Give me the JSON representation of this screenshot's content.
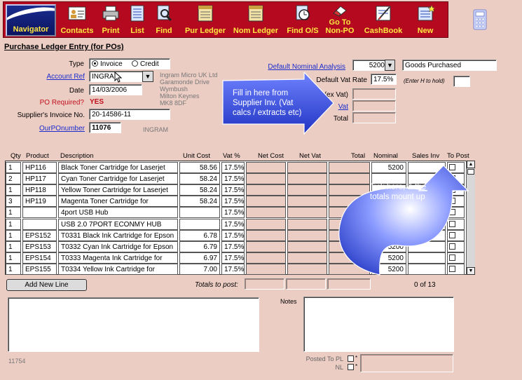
{
  "toolbar": {
    "navigator": "Navigator",
    "buttons": [
      {
        "label": "Contacts",
        "icon": "contacts-icon"
      },
      {
        "label": "Print",
        "icon": "printer-icon"
      },
      {
        "label": "List",
        "icon": "list-icon"
      },
      {
        "label": "Find",
        "icon": "find-icon"
      },
      {
        "label": "Pur Ledger",
        "icon": "ledger-icon"
      },
      {
        "label": "Nom Ledger",
        "icon": "ledger-icon"
      },
      {
        "label": "Find O/S",
        "icon": "stopwatch-icon"
      },
      {
        "label": "Go To",
        "label2": "Non-PO",
        "icon": "eraser-icon"
      },
      {
        "label": "CashBook",
        "icon": "cashbook-icon"
      },
      {
        "label": "New",
        "icon": "new-icon"
      }
    ]
  },
  "page_title": "Purchase Ledger Entry (for POs)",
  "form": {
    "type_label": "Type",
    "type_options": [
      "Invoice",
      "Credit"
    ],
    "account_ref_label": "Account Ref",
    "account_ref_value": "INGRA",
    "supplier_address": [
      "Ingram Micro UK Ltd",
      "Garamonde Drive",
      "Wymbush",
      "Milton Keynes",
      "MK8 8DF"
    ],
    "date_label": "Date",
    "date_value": "14/03/2006",
    "po_required_label": "PO Required?",
    "po_required_value": "YES",
    "supplier_invoice_label": "Supplier's Invoice  No.",
    "supplier_invoice_value": "20-14586-11",
    "our_po_label": "OurPOnumber",
    "our_po_value": "11076",
    "our_po_supplier": "INGRAM",
    "default_nominal_label": "Default Nominal Analysis",
    "default_nominal_code": "5200",
    "default_nominal_desc": "Goods Purchased",
    "default_vat_label": "Default Vat Rate",
    "default_vat_value": "17.5%",
    "hold_hint": "(Enter H to hold)",
    "ex_vat_label": "(ex Vat)",
    "vat_label": "Vat",
    "total_label": "Total"
  },
  "callouts": {
    "fill_in": "Fill in here from Supplier Inv. (Vat calcs / extracts etc)",
    "tick_here": "Tick here, & the totals mount up"
  },
  "table": {
    "headers": [
      "Qty",
      "Product",
      "Description",
      "Unit Cost",
      "Vat %",
      "Net Cost",
      "Net Vat",
      "Total",
      "Nominal",
      "Sales Inv",
      "To Post"
    ],
    "rows": [
      {
        "qty": "1",
        "product": "HP116",
        "description": "Black Toner Cartridge for Laserjet",
        "unit_cost": "58.56",
        "vat": "17.5%",
        "nominal": "5200"
      },
      {
        "qty": "2",
        "product": "HP117",
        "description": "Cyan Toner Cartridge for Laserjet",
        "unit_cost": "58.24",
        "vat": "17.5%",
        "nominal": ""
      },
      {
        "qty": "1",
        "product": "HP118",
        "description": "Yellow Toner Cartridge for Laserjet",
        "unit_cost": "58.24",
        "vat": "17.5%",
        "nominal": ""
      },
      {
        "qty": "3",
        "product": "HP119",
        "description": "Magenta Toner Cartridge for",
        "unit_cost": "58.24",
        "vat": "17.5%",
        "nominal": ""
      },
      {
        "qty": "1",
        "product": "",
        "description": "4port USB Hub",
        "unit_cost": "",
        "vat": "17.5%",
        "nominal": ""
      },
      {
        "qty": "1",
        "product": "",
        "description": " USB 2.0 7PORT ECONMY HUB",
        "unit_cost": "",
        "vat": "17.5%",
        "nominal": ""
      },
      {
        "qty": "1",
        "product": "EPS152",
        "description": "T0331 Black Ink Cartridge for Epson",
        "unit_cost": "6.78",
        "vat": "17.5%",
        "nominal": "5200"
      },
      {
        "qty": "1",
        "product": "EPS153",
        "description": "T0332 Cyan Ink Cartridge for Epson",
        "unit_cost": "6.79",
        "vat": "17.5%",
        "nominal": "5200"
      },
      {
        "qty": "1",
        "product": "EPS154",
        "description": "T0333 Magenta Ink Cartridge for",
        "unit_cost": "6.97",
        "vat": "17.5%",
        "nominal": "5200"
      },
      {
        "qty": "1",
        "product": "EPS155",
        "description": "T0334 Yellow Ink Cartridge for",
        "unit_cost": "7.00",
        "vat": "17.5%",
        "nominal": "5200"
      }
    ],
    "add_new_line": "Add  New Line",
    "totals_label": "Totals to post:",
    "count": "0 of 13"
  },
  "notes_label": "Notes",
  "record_id": "11754",
  "posted_to_pl_label": "Posted To PL",
  "nl_label": "NL",
  "colors": {
    "toolbar": "#b4091f",
    "toolbar_text": "#ffe640",
    "background": "#eccdc4",
    "link": "#1a2ccc",
    "callout": "#3a4fd8"
  }
}
